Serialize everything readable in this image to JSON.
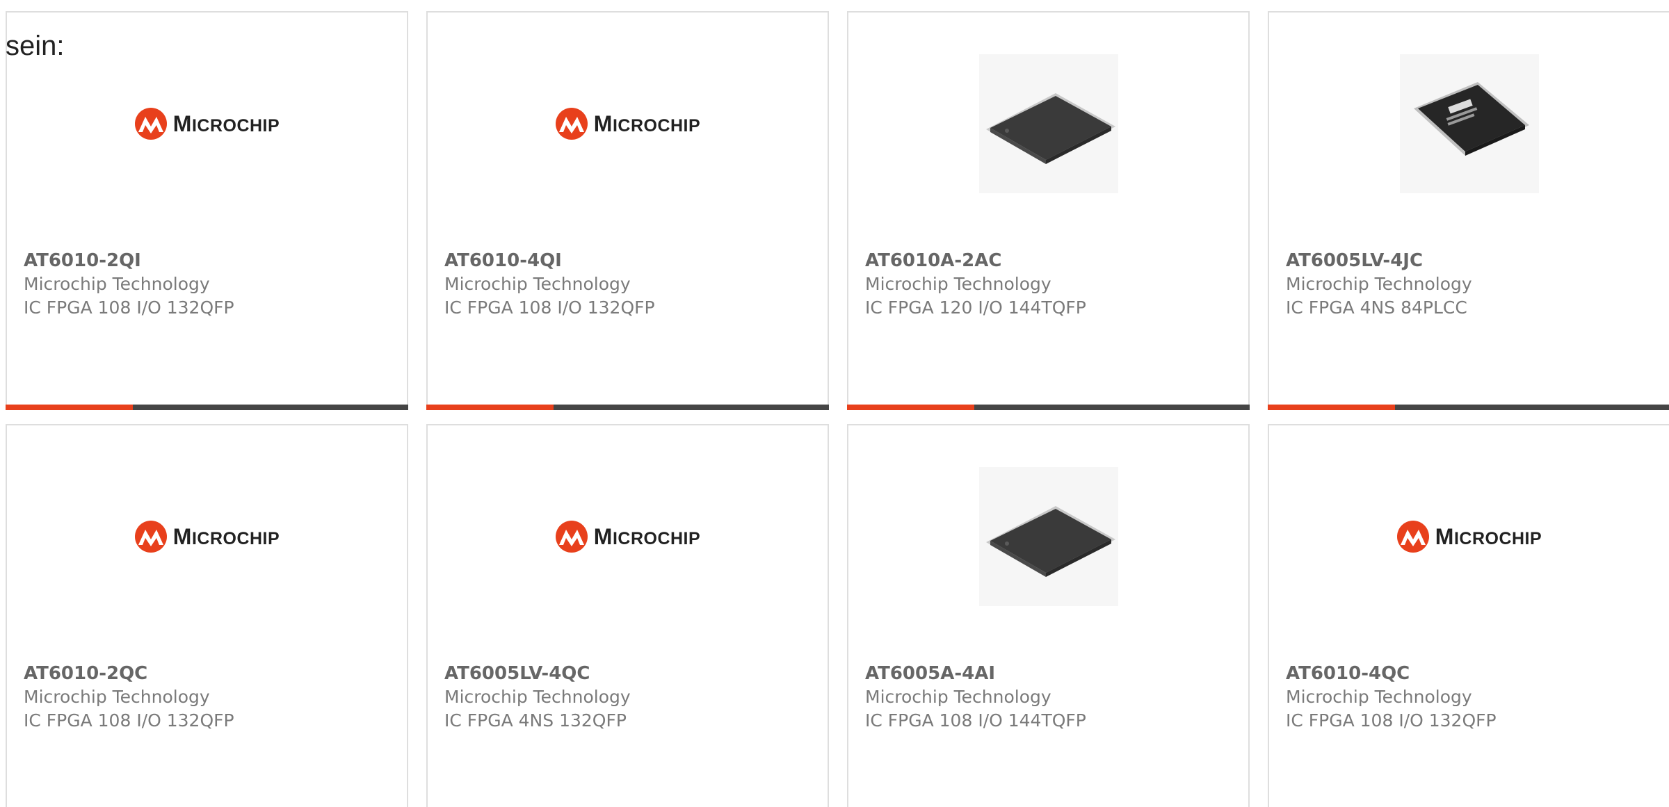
{
  "page": {
    "label": "sein:"
  },
  "logo": {
    "text_first": "M",
    "text_rest": "ICROCHIP",
    "brand_color": "#e8401c"
  },
  "colors": {
    "accent": "#e8401c",
    "bar_dark": "#454545",
    "card_border": "#dedede",
    "text": "#666666"
  },
  "products": [
    {
      "part": "AT6010-2QI",
      "manufacturer": "Microchip Technology",
      "description": "IC FPGA 108 I/O 132QFP",
      "image": "microchip-logo"
    },
    {
      "part": "AT6010-4QI",
      "manufacturer": "Microchip Technology",
      "description": "IC FPGA 108 I/O 132QFP",
      "image": "microchip-logo"
    },
    {
      "part": "AT6010A-2AC",
      "manufacturer": "Microchip Technology",
      "description": "IC FPGA 120 I/O 144TQFP",
      "image": "tqfp-chip-photo"
    },
    {
      "part": "AT6005LV-4JC",
      "manufacturer": "Microchip Technology",
      "description": "IC FPGA 4NS 84PLCC",
      "image": "plcc-chip-photo"
    },
    {
      "part": "AT6010-2QC",
      "manufacturer": "Microchip Technology",
      "description": "IC FPGA 108 I/O 132QFP",
      "image": "microchip-logo"
    },
    {
      "part": "AT6005LV-4QC",
      "manufacturer": "Microchip Technology",
      "description": "IC FPGA 4NS 132QFP",
      "image": "microchip-logo"
    },
    {
      "part": "AT6005A-4AI",
      "manufacturer": "Microchip Technology",
      "description": "IC FPGA 108 I/O 144TQFP",
      "image": "tqfp-chip-photo"
    },
    {
      "part": "AT6010-4QC",
      "manufacturer": "Microchip Technology",
      "description": "IC FPGA 108 I/O 132QFP",
      "image": "microchip-logo"
    }
  ]
}
